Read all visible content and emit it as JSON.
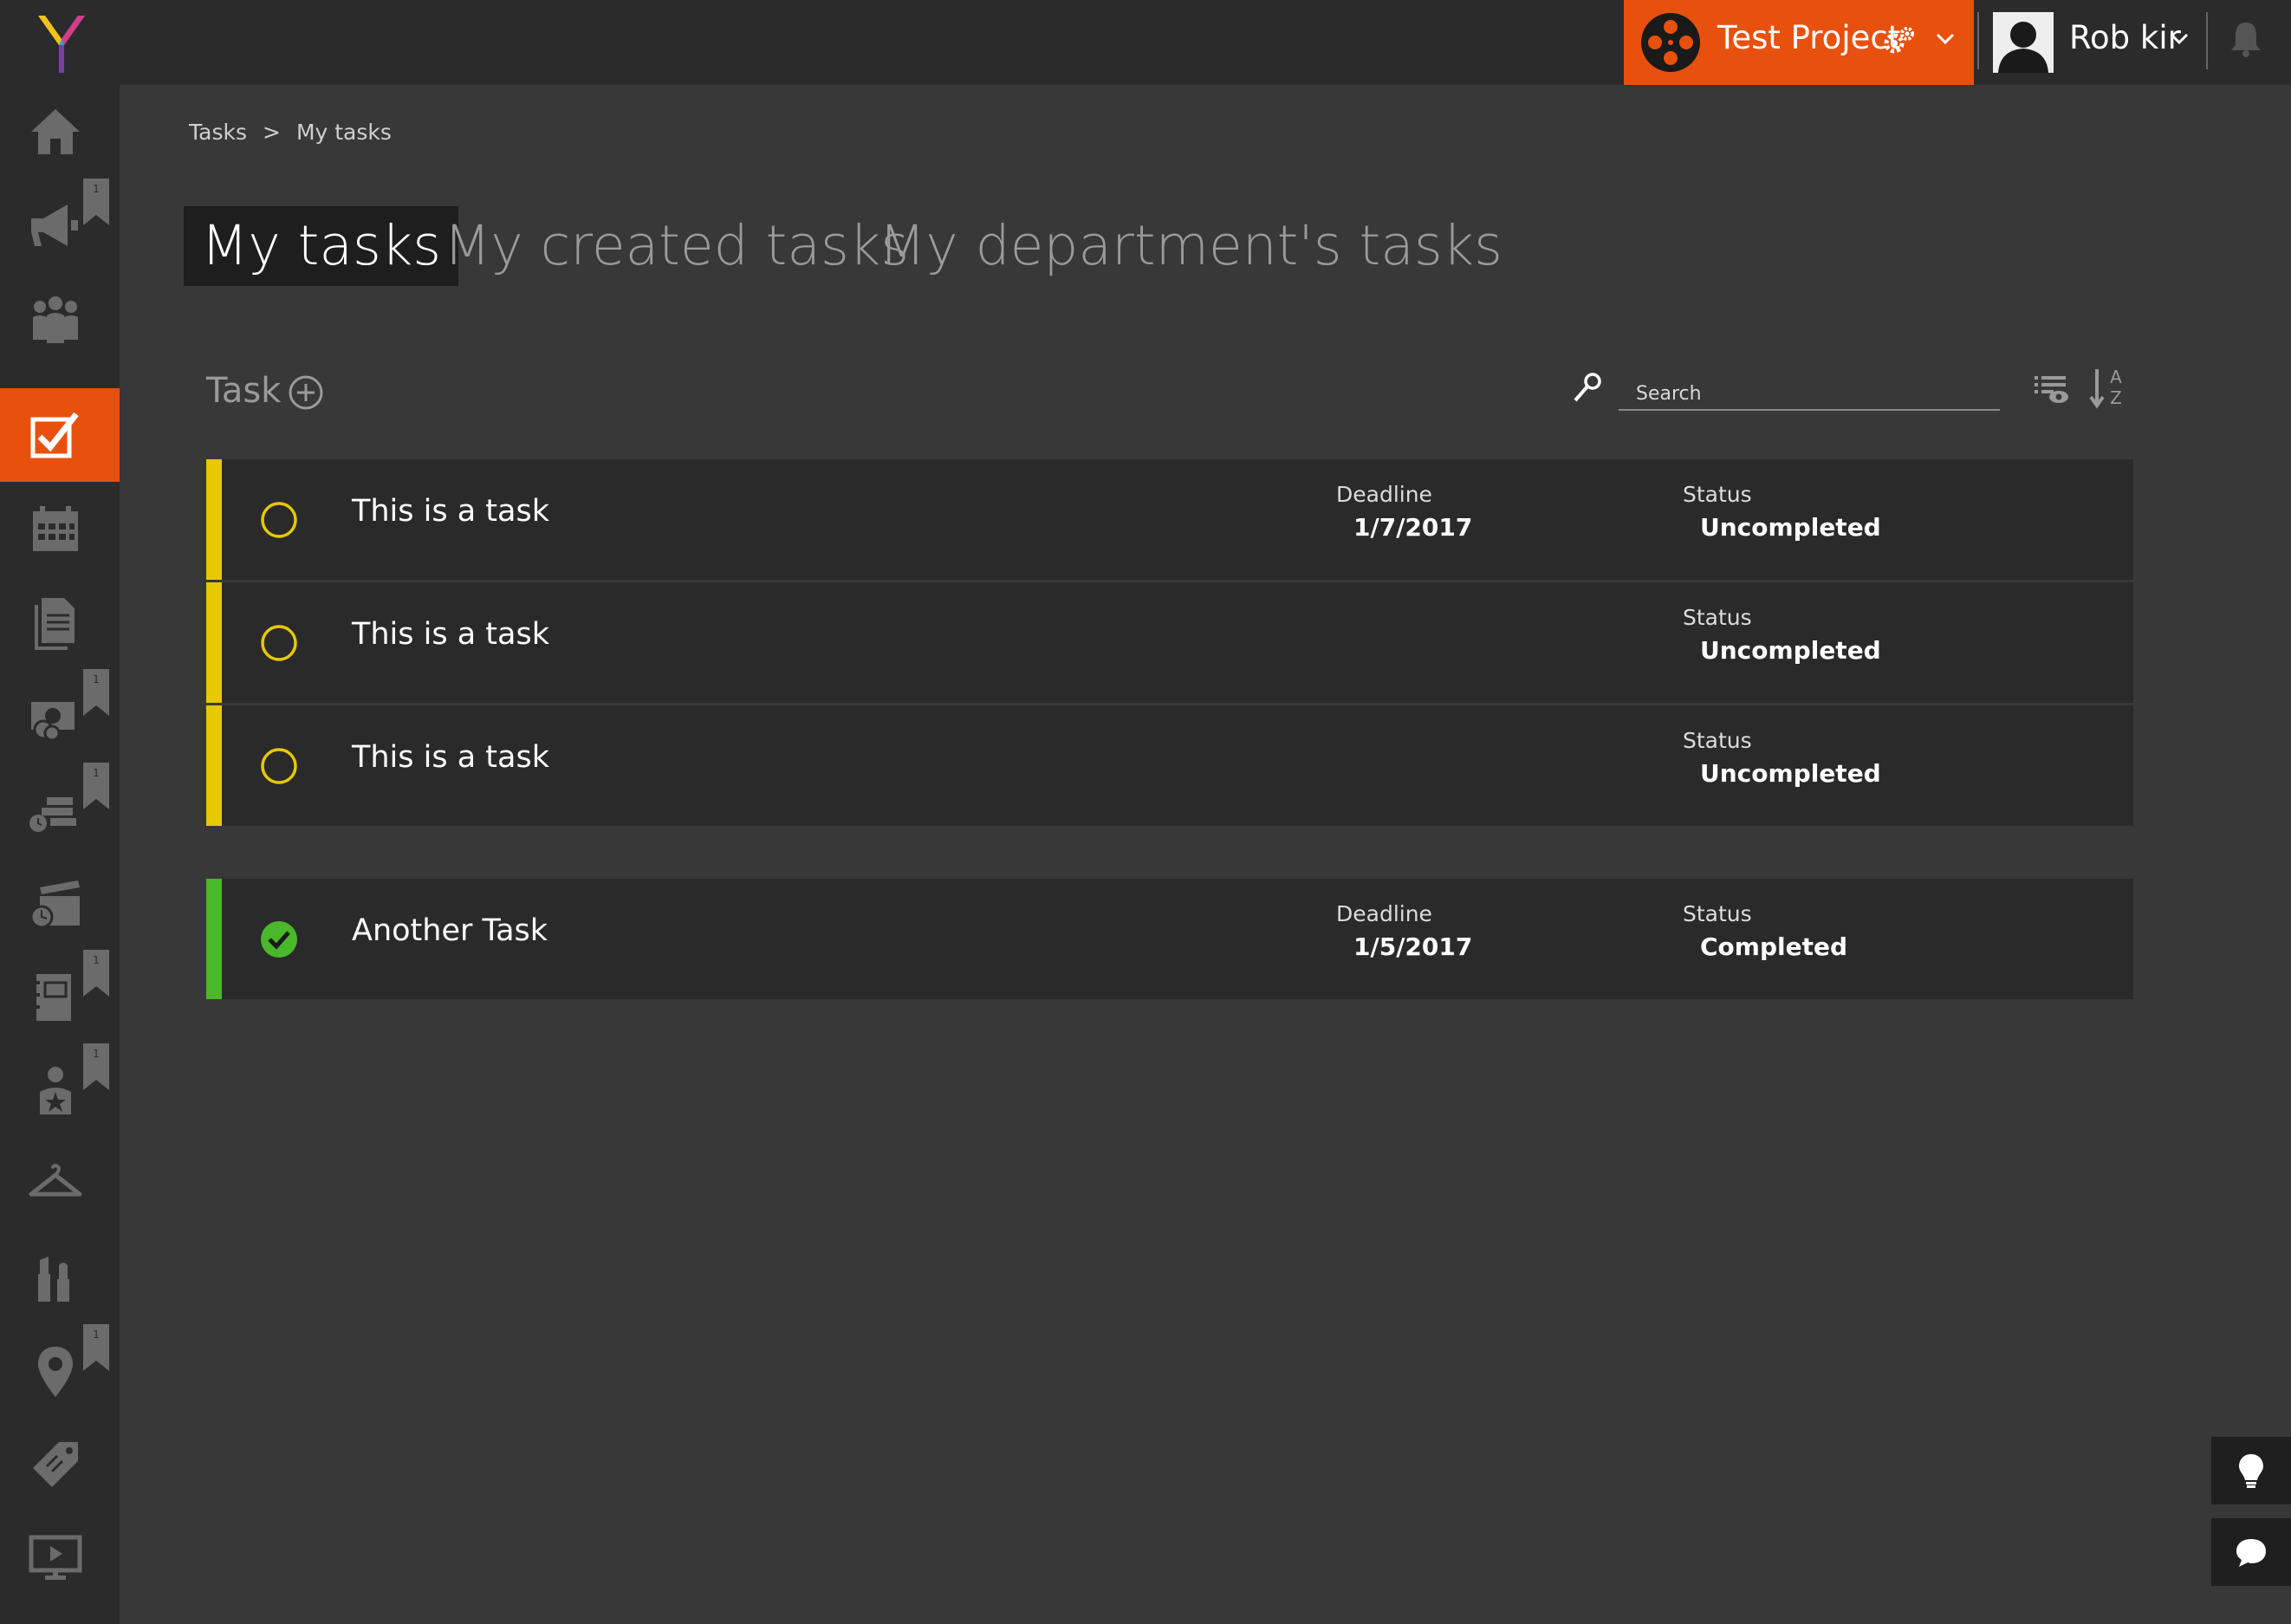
{
  "header": {
    "project_name": "Test Project",
    "user_name": "Rob kir",
    "accent_color": "#e8500e"
  },
  "sidebar": {
    "items": [
      {
        "icon": "home-icon"
      },
      {
        "icon": "megaphone-icon",
        "badge": "1"
      },
      {
        "icon": "people-icon"
      },
      {
        "icon": "tasks-checkbox-icon",
        "active": true
      },
      {
        "icon": "calendar-icon"
      },
      {
        "icon": "documents-icon"
      },
      {
        "icon": "budget-money-icon",
        "badge": "1"
      },
      {
        "icon": "schedule-stripboard-icon",
        "badge": "1"
      },
      {
        "icon": "clapperboard-icon"
      },
      {
        "icon": "notebook-icon",
        "badge": "1"
      },
      {
        "icon": "cast-star-icon",
        "badge": "1"
      },
      {
        "icon": "costume-hanger-icon"
      },
      {
        "icon": "makeup-icon"
      },
      {
        "icon": "location-pin-icon",
        "badge": "1"
      },
      {
        "icon": "tag-props-icon"
      },
      {
        "icon": "screen-play-icon"
      }
    ]
  },
  "breadcrumb": {
    "root": "Tasks",
    "separator": ">",
    "current": "My tasks"
  },
  "tabs": [
    {
      "label": "My tasks",
      "active": true
    },
    {
      "label": "My created tasks"
    },
    {
      "label": "My department's tasks"
    }
  ],
  "task_list": {
    "header_label": "Task",
    "search_placeholder": "Search",
    "deadline_label": "Deadline",
    "status_label": "Status",
    "uncompleted_color": "#e8c800",
    "completed_color": "#49b82b",
    "groups": [
      {
        "tasks": [
          {
            "title": "This is a task",
            "deadline": "1/7/2017",
            "status": "Uncompleted",
            "completed": false
          },
          {
            "title": "This is a task",
            "deadline": "",
            "status": "Uncompleted",
            "completed": false
          },
          {
            "title": "This is a task",
            "deadline": "",
            "status": "Uncompleted",
            "completed": false
          }
        ]
      },
      {
        "tasks": [
          {
            "title": "Another Task",
            "deadline": "1/5/2017",
            "status": "Completed",
            "completed": true
          }
        ]
      }
    ]
  }
}
